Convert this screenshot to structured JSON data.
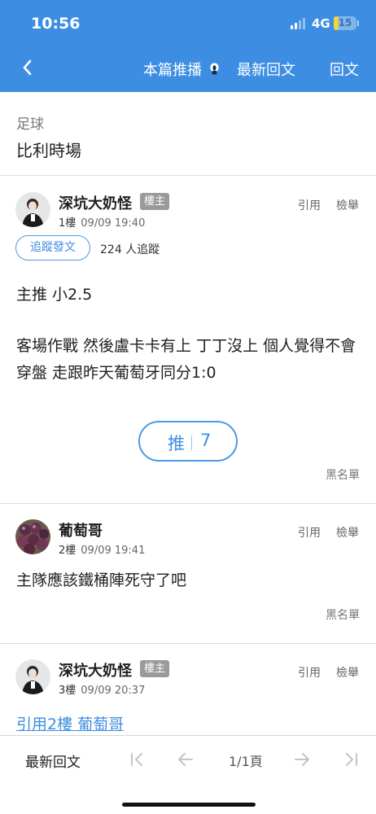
{
  "status_bar": {
    "time": "10:56",
    "network": "4G",
    "battery": "15",
    "battery_level": 0.15
  },
  "nav": {
    "back_icon": "chevron-left-icon",
    "recommend_label": "本篇推播",
    "recommend_icon": "lightbulb-icon",
    "latest_label": "最新回文",
    "reply_label": "回文"
  },
  "thread": {
    "board": "足球",
    "title": "比利時場"
  },
  "posts": [
    {
      "author": "深坑大奶怪",
      "badge": "樓主",
      "floor": "1樓",
      "time": "09/09 19:40",
      "quote_label": "引用",
      "report_label": "檢舉",
      "follow_label": "追蹤發文",
      "follow_count": "224 人追蹤",
      "body_line1": "主推 小2.5",
      "body_line2": "客場作戰 然後盧卡卡有上 丁丁沒上 個人覺得不會穿盤 走跟昨天葡萄牙同分1:0",
      "push_label": "推",
      "push_count": "7",
      "blacklist_label": "黑名單"
    },
    {
      "author": "葡萄哥",
      "floor": "2樓",
      "time": "09/09 19:41",
      "quote_label": "引用",
      "report_label": "檢舉",
      "body": "主隊應該鐵桶陣死守了吧",
      "blacklist_label": "黑名單"
    },
    {
      "author": "深坑大奶怪",
      "badge": "樓主",
      "floor": "3樓",
      "time": "09/09 20:37",
      "quote_label": "引用",
      "report_label": "檢舉",
      "quote_link": "引用2樓 葡萄哥"
    }
  ],
  "toolbar": {
    "latest_label": "最新回文",
    "page_label": "1/1頁",
    "icons": [
      "first-page-icon",
      "prev-page-icon",
      "next-page-icon",
      "last-page-icon"
    ]
  },
  "colors": {
    "brand": "#3d8ee3",
    "badge": "#9a9a9a",
    "battery": "#f4d23c"
  }
}
